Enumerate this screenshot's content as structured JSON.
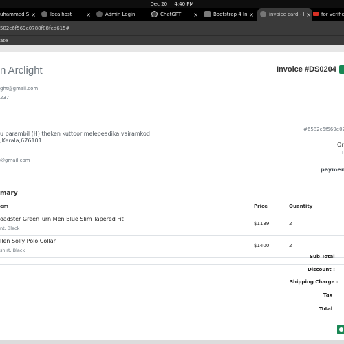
{
  "os": {
    "date": "Dec 20",
    "time": "4:40 PM"
  },
  "tabs": [
    {
      "label": "uhammed S",
      "color": "#6a6a6a"
    },
    {
      "label": "localhost",
      "color": "#6a6a6a"
    },
    {
      "label": "Admin Login",
      "color": "#5a5a5a"
    },
    {
      "label": "ChatGPT",
      "color": "#444"
    },
    {
      "label": "Bootstrap 4 In",
      "color": "#7a7a7a"
    },
    {
      "label": "invoice card - I",
      "color": "#777"
    },
    {
      "label": "for verificat",
      "color": "#d93025"
    }
  ],
  "close_glyph": "×",
  "url": "582c6f569e0788f88fed615#",
  "bookmarks": {
    "label": "ate"
  },
  "invoice": {
    "brand": "n Arclight",
    "email": "ght@gmail.com",
    "phone": "237",
    "number": "Invoice #DS0204",
    "address_line1": "u parambil (H) theken kuttoor,melepeadika,vairamkod",
    "address_line2": ",Kerala,676101",
    "customer_email": "@gmail.com",
    "order_id": "#6582c6f569e07",
    "right_text1": "Or",
    "right_text2": "I",
    "payment_label": "paymen"
  },
  "summary": {
    "title": "mary",
    "headers": {
      "item": "em",
      "price": "Price",
      "quantity": "Quantity"
    },
    "rows": [
      {
        "name": "oadster GreenTurn Men Blue Slim Tapered Fit",
        "meta": "nt, Black",
        "price": "$1139",
        "qty": "2"
      },
      {
        "name": "llen Solly Polo Collar",
        "meta": "shirt, Black",
        "price": "$1400",
        "qty": "2"
      }
    ],
    "totals": {
      "subtotal": "Sub Total",
      "discount": "Discount :",
      "shipping": "Shipping Charge :",
      "tax": "Tax",
      "total": "Total"
    }
  },
  "colors": {
    "accent_green": "#198754",
    "tab_active": "#3a3a3a"
  }
}
